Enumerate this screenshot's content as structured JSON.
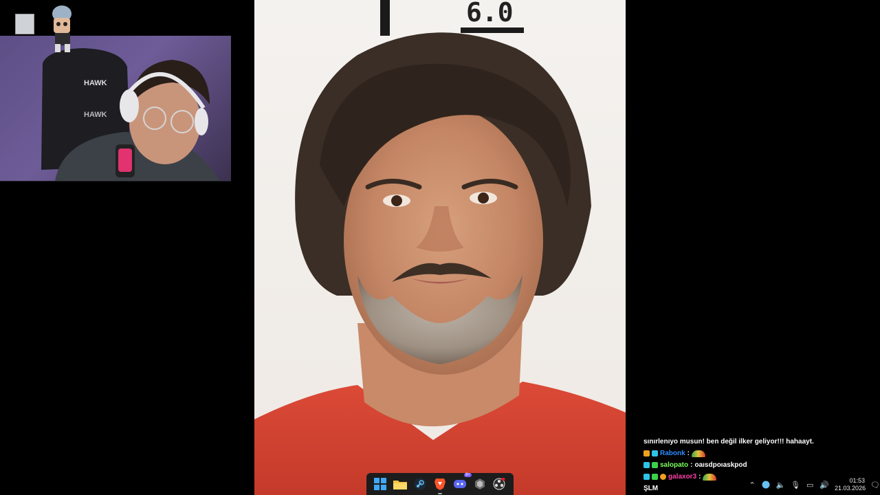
{
  "photo": {
    "measure_label": "6.0"
  },
  "chat": {
    "lines": [
      {
        "user": "",
        "color": "#ffffff",
        "message": "sınırlenıyo musun! ben değil ilker geliyor!!! hahaayt."
      },
      {
        "user": "Rabonk",
        "color": "#2e8bff",
        "message": ""
      },
      {
        "user": "salopato",
        "color": "#7dff5e",
        "message": "oaısdpoıaskpod"
      },
      {
        "user": "galaxor3",
        "color": "#ff3fa6",
        "message": ""
      },
      {
        "user": "",
        "color": "#ffffff",
        "message": "ŞLM"
      }
    ]
  },
  "taskbar": {
    "icons": [
      "windows-start-icon",
      "file-explorer-icon",
      "steam-icon",
      "brave-browser-icon",
      "discord-icon",
      "app-icon",
      "obs-icon"
    ],
    "discord_badge": "9+"
  },
  "tray": {
    "time": "01:53",
    "date": "21.03.2026"
  }
}
